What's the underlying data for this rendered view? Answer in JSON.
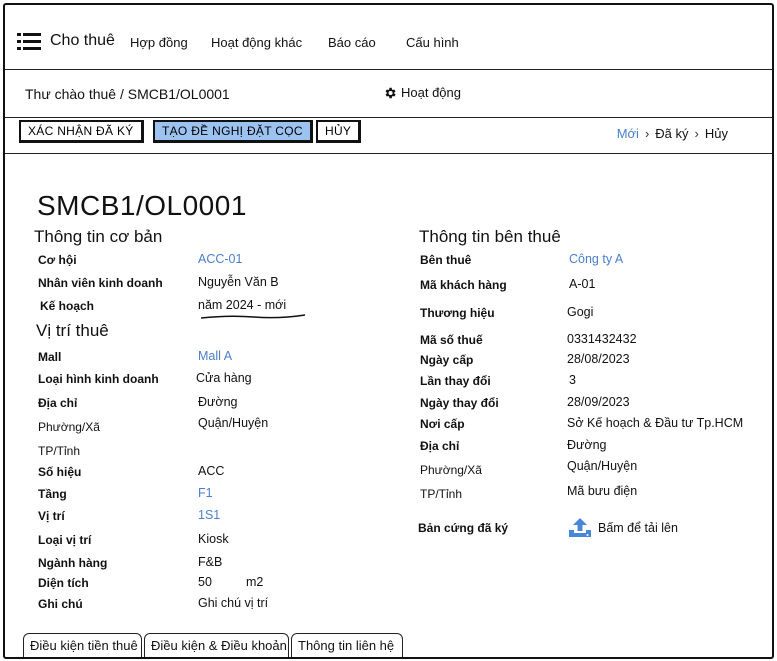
{
  "nav": {
    "brand": "Cho thuê",
    "items": [
      "Hợp đồng",
      "Hoạt động khác",
      "Báo cáo",
      "Cấu hình"
    ]
  },
  "breadcrumb": "Thư chào thuê / SMCB1/OL0001",
  "activity_label": "Hoạt động",
  "actions": {
    "confirm": "XÁC NHẬN ĐÃ KÝ",
    "deposit": "TẠO ĐỀ NGHỊ ĐẶT CỌC",
    "cancel": "HỦY"
  },
  "status": [
    "Mới",
    "Đã ký",
    "Hủy"
  ],
  "record_title": "SMCB1/OL0001",
  "basic": {
    "title": "Thông tin cơ bản",
    "opportunity_label": "Cơ hội",
    "opportunity": "ACC-01",
    "salesperson_label": "Nhân viên kinh doanh",
    "salesperson": "Nguyễn Văn B",
    "plan_label": "Kế hoạch",
    "plan": "năm 2024 - mới"
  },
  "location": {
    "title": "Vị trí thuê",
    "mall_label": "Mall",
    "mall": "Mall A",
    "biz_type_label": "Loại hình kinh doanh",
    "biz_type": "Cửa hàng",
    "address_label": "Địa chỉ",
    "address": "Đường",
    "ward_label": "Phường/Xã",
    "district": "Quận/Huyện",
    "city_label": "TP/Tỉnh",
    "code_label": "Số hiệu",
    "code": "ACC",
    "floor_label": "Tầng",
    "floor": "F1",
    "position_label": "Vị trí",
    "position": "1S1",
    "position_type_label": "Loại vị trí",
    "position_type": "Kiosk",
    "category_label": "Ngành hàng",
    "category": "F&B",
    "area_label": "Diện tích",
    "area": "50",
    "area_unit": "m2",
    "note_label": "Ghi chú",
    "note": "Ghi chú vị trí"
  },
  "tenant": {
    "title": "Thông tin bên thuê",
    "tenant_label": "Bên thuê",
    "tenant": "Công ty A",
    "customer_code_label": "Mã khách hàng",
    "customer_code": "A-01",
    "brand_label": "Thương hiệu",
    "brand": "Gogi",
    "tax_code_label": "Mã số thuế",
    "tax_code": "0331432432",
    "issue_date_label": "Ngày cấp",
    "issue_date": "28/08/2023",
    "change_count_label": "Lần thay đổi",
    "change_count": "3",
    "change_date_label": "Ngày thay đổi",
    "change_date": "28/09/2023",
    "issued_by_label": "Nơi cấp",
    "issued_by": "Sở Kế hoạch & Đầu tư Tp.HCM",
    "address_label": "Địa chỉ",
    "address": "Đường",
    "ward_label": "Phường/Xã",
    "district": "Quận/Huyện",
    "city_label": "TP/Tỉnh",
    "postal": "Mã bưu điện",
    "signed_copy_label": "Bản cứng đã ký",
    "upload_label": "Bấm để tải lên"
  },
  "tabs": [
    "Điều kiện tiền thuê",
    "Điều kiện & Điều khoản",
    "Thông tin liên hệ"
  ]
}
